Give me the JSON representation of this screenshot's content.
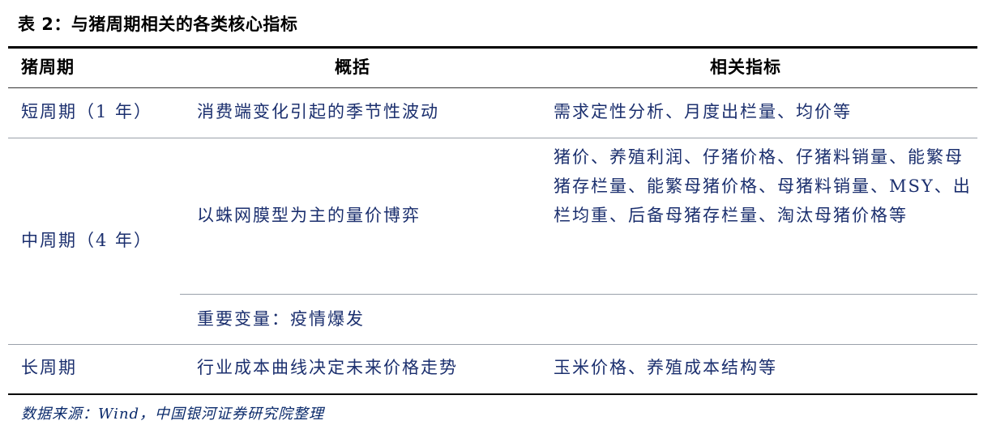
{
  "title": "表 2：与猪周期相关的各类核心指标",
  "headers": {
    "cycle": "猪周期",
    "summary": "概括",
    "indicators": "相关指标"
  },
  "rows": [
    {
      "cycle": "短周期（1 年）",
      "summary": "消费端变化引起的季节性波动",
      "indicators": "需求定性分析、月度出栏量、均价等"
    },
    {
      "cycle": "中周期（4 年）",
      "summary": "以蛛网膜型为主的量价博弈",
      "indicators": "猪价、养殖利润、仔猪价格、仔猪料销量、能繁母猪存栏量、能繁母猪价格、母猪料销量、MSY、出栏均重、后备母猪存栏量、淘汰母猪价格等",
      "summary2": "重要变量：疫情爆发"
    },
    {
      "cycle": "长周期",
      "summary": "行业成本曲线决定未来价格走势",
      "indicators": "玉米价格、养殖成本结构等"
    }
  ],
  "source": "数据来源：Wind，中国银河证券研究院整理"
}
